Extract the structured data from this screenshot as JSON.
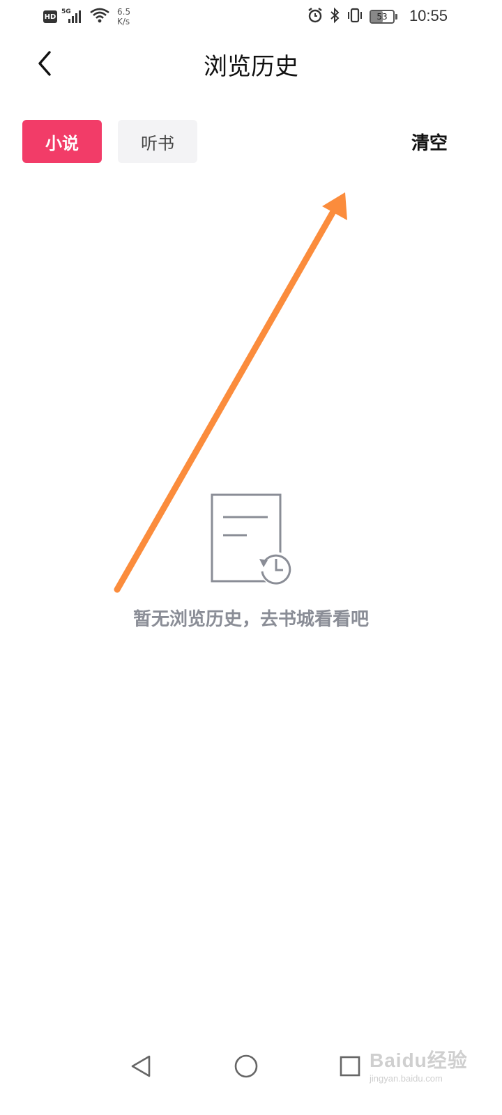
{
  "status_bar": {
    "hd": "HD",
    "network": "5G",
    "speed_value": "6.5",
    "speed_unit": "K/s",
    "battery": "53",
    "battery_level": 0.53,
    "time": "10:55",
    "icons": [
      "hd-icon",
      "signal-icon",
      "wifi-icon",
      "alarm-icon",
      "bluetooth-icon",
      "vibrate-icon",
      "battery-icon"
    ]
  },
  "nav": {
    "title": "浏览历史",
    "back_icon": "chevron-left-icon"
  },
  "tabs": [
    {
      "label": "小说",
      "active": true
    },
    {
      "label": "听书",
      "active": false
    }
  ],
  "clear_label": "清空",
  "empty": {
    "icon": "document-history-icon",
    "message": "暂无浏览历史，去书城看看吧"
  },
  "system_nav": [
    "back-triangle-icon",
    "home-circle-icon",
    "recents-square-icon"
  ],
  "watermark": {
    "brand": "Baidu经验",
    "url": "jingyan.baidu.com"
  },
  "colors": {
    "accent": "#f23c68",
    "arrow": "#fb8c3c",
    "muted": "#8a8d96"
  }
}
